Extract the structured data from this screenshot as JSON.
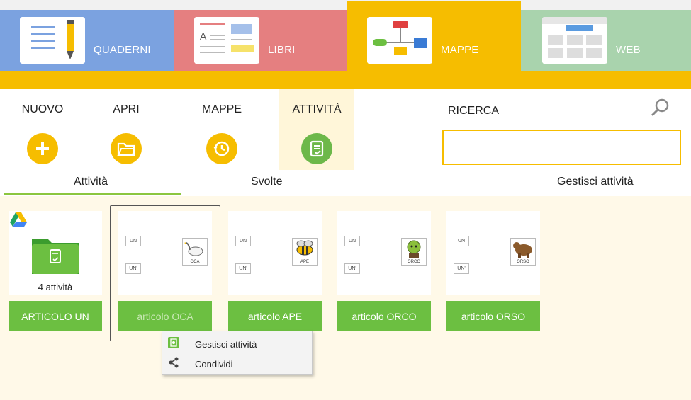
{
  "apps": {
    "tabs": [
      {
        "label": "QUADERNI",
        "color": "#7ba2e0"
      },
      {
        "label": "LIBRI",
        "color": "#e57f80"
      },
      {
        "label": "MAPPE",
        "color": "#f6bd00",
        "active": true
      },
      {
        "label": "WEB",
        "color": "#a9d3ad"
      }
    ]
  },
  "toolbar": {
    "new_label": "NUOVO",
    "open_label": "APRI",
    "maps_label": "MAPPE",
    "activity_label": "ATTIVITÀ",
    "search_label": "RICERCA",
    "search_value": ""
  },
  "subtabs": {
    "activities": "Attività",
    "done": "Svolte",
    "manage": "Gestisci attività"
  },
  "cards": [
    {
      "label": "ARTICOLO UN",
      "count": "4 attività",
      "kind": "folder"
    },
    {
      "label": "articolo OCA",
      "word1": "UN",
      "word2": "UN'",
      "pic": "OCA",
      "selected": true
    },
    {
      "label": "articolo APE",
      "word1": "UN",
      "word2": "UN'",
      "pic": "APE"
    },
    {
      "label": "articolo ORCO",
      "word1": "UN",
      "word2": "UN'",
      "pic": "ORCO"
    },
    {
      "label": "articolo ORSO",
      "word1": "UN",
      "word2": "UN'",
      "pic": "ORSO"
    }
  ],
  "context_menu": {
    "items": [
      {
        "label": "Gestisci attività",
        "icon": "manage-icon"
      },
      {
        "label": "Condividi",
        "icon": "share-icon"
      }
    ]
  },
  "colors": {
    "accent_yellow": "#f6bd00",
    "green": "#6cbf41",
    "content_bg": "#fff9e8"
  }
}
